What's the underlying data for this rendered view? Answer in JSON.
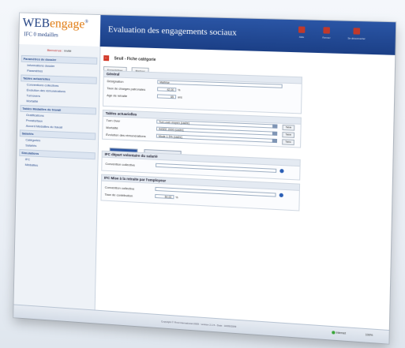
{
  "header": {
    "logo_main": "WEB",
    "logo_accent": "engage",
    "logo_mark": "®",
    "logo_sub": "IFC 0 medailles",
    "title": "Evaluation des engagements sociaux",
    "buttons": [
      {
        "label": "Aide",
        "color": "#c0392b"
      },
      {
        "label": "Fermer",
        "color": "#c0392b"
      },
      {
        "label": "Se déconnecter",
        "color": "#c0392b"
      }
    ]
  },
  "sidebar": {
    "welcome": "Bienvenue",
    "welcome_user": "invité",
    "sections": [
      {
        "label": "Paramètres de dossier",
        "items": [
          "Informations dossier",
          "Paramètres"
        ]
      },
      {
        "label": "Tables actuarielles",
        "items": [
          "Conventions collectives",
          "Évolution des rémunérations",
          "Turnovers",
          "Mortalité"
        ]
      },
      {
        "label": "Tables Médailles du travail",
        "items": [
          "Gratifications",
          "Prorata/taux",
          "Accord Médailles du travail"
        ]
      },
      {
        "label": "Salariés",
        "items": [
          "Catégories",
          "Salariés"
        ]
      },
      {
        "label": "Simulations",
        "items": [
          "IFC",
          "Médailles"
        ]
      }
    ]
  },
  "main": {
    "page_title": "Seuil - Fiche catégorie",
    "toolbar": {
      "save": "Enregistrer",
      "back": "Retour"
    },
    "general": {
      "header": "Général",
      "designation_label": "Désignation",
      "designation_value": "Maîtrise",
      "charges_label": "Taux de charges patronales",
      "charges_value": "42,00",
      "charges_unit": "%",
      "age_label": "Age de retraite",
      "age_value": "65",
      "age_unit": "ans"
    },
    "tables": {
      "header": "Tables actuarielles",
      "rows": [
        {
          "label": "Turn Over",
          "value": "Turn over moyen (cadre)",
          "button": "Table"
        },
        {
          "label": "Mortalité",
          "value": "INSEE 2000 (cadre)",
          "button": "Table"
        },
        {
          "label": "Évolution des rémunérations",
          "value": "Mode 1 5% (cadre)",
          "button": "Table"
        }
      ]
    },
    "tabs": [
      {
        "label": "IFC",
        "active": true
      },
      {
        "label": "Médailles",
        "active": false
      }
    ],
    "ifc_depart": {
      "header": "IFC départ volontaire du salarié",
      "convention_label": "Convention collective",
      "convention_value": ""
    },
    "ifc_mise": {
      "header": "IFC Mise à la retraite par l'employeur",
      "convention_label": "Convention collective",
      "convention_value": "",
      "rate_label": "Taux de contribution",
      "rate_value": "50,00",
      "rate_unit": "%"
    }
  },
  "footer": {
    "copyright": "Copyright © First International 2009 - version 2.1.5 - Date : 10/09/2009",
    "status": "Internet",
    "zoom": "100%"
  }
}
